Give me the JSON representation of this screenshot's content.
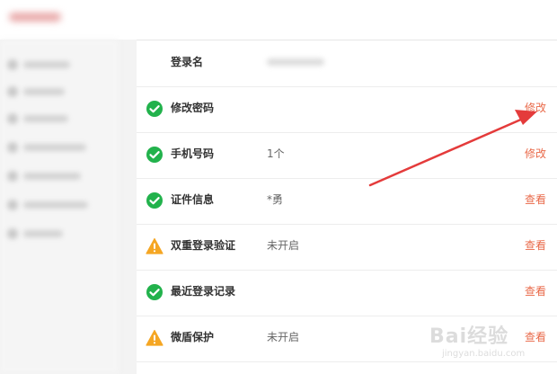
{
  "colors": {
    "accent": "#e96a4a",
    "success": "#22b24c",
    "warning": "#f5a623",
    "arrow": "#e43b3b"
  },
  "security_items": [
    {
      "label": "登录名",
      "value": "",
      "value_blurred": true,
      "status": "none",
      "action": ""
    },
    {
      "label": "修改密码",
      "value": "",
      "status": "check-circle-icon",
      "action": "修改"
    },
    {
      "label": "手机号码",
      "value": "1个",
      "status": "check-circle-icon",
      "action": "修改"
    },
    {
      "label": "证件信息",
      "value": "*勇",
      "status": "check-circle-icon",
      "action": "查看"
    },
    {
      "label": "双重登录验证",
      "value": "未开启",
      "status": "warning-triangle-icon",
      "action": "查看"
    },
    {
      "label": "最近登录记录",
      "value": "",
      "status": "check-circle-icon",
      "action": "查看"
    },
    {
      "label": "微盾保护",
      "value": "未开启",
      "status": "warning-triangle-icon",
      "action": "查看"
    }
  ],
  "watermark": {
    "brand": "Bai经验",
    "url": "jingyan.baidu.com"
  }
}
